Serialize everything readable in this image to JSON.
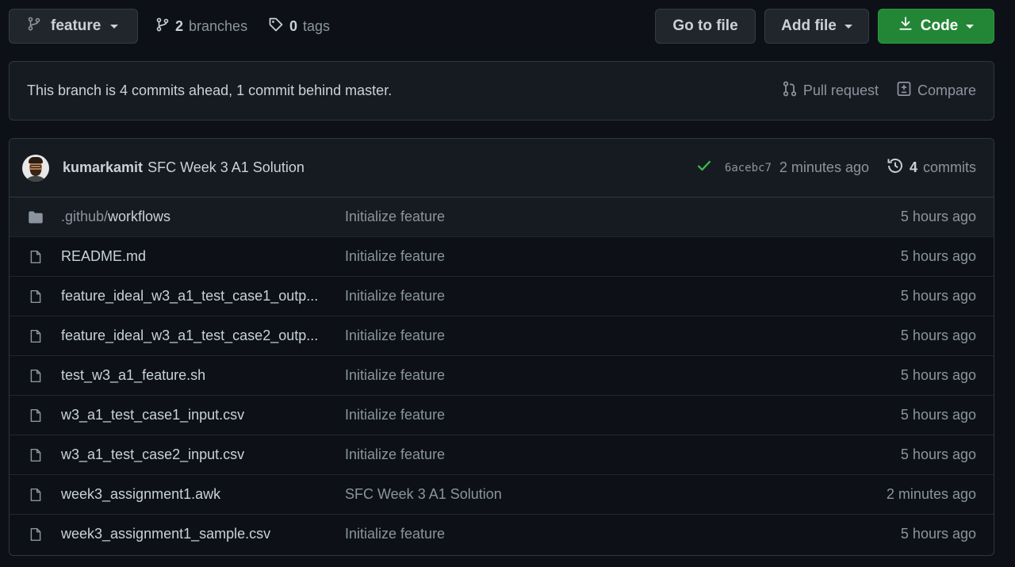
{
  "toolbar": {
    "branch": "feature",
    "branches_count": "2",
    "branches_label": "branches",
    "tags_count": "0",
    "tags_label": "tags",
    "go_to_file": "Go to file",
    "add_file": "Add file",
    "code": "Code"
  },
  "notice": {
    "text": "This branch is 4 commits ahead, 1 commit behind master.",
    "pull_request": "Pull request",
    "compare": "Compare"
  },
  "latest_commit": {
    "author": "kumarkamit",
    "message": "SFC Week 3 A1 Solution",
    "sha": "6acebc7",
    "time": "2 minutes ago",
    "commits_count": "4",
    "commits_label": "commits"
  },
  "files": [
    {
      "type": "folder",
      "name_prefix": ".github/",
      "name": "workflows",
      "message": "Initialize feature",
      "age": "5 hours ago"
    },
    {
      "type": "file",
      "name_prefix": "",
      "name": "README.md",
      "message": "Initialize feature",
      "age": "5 hours ago"
    },
    {
      "type": "file",
      "name_prefix": "",
      "name": "feature_ideal_w3_a1_test_case1_outp...",
      "message": "Initialize feature",
      "age": "5 hours ago"
    },
    {
      "type": "file",
      "name_prefix": "",
      "name": "feature_ideal_w3_a1_test_case2_outp...",
      "message": "Initialize feature",
      "age": "5 hours ago"
    },
    {
      "type": "file",
      "name_prefix": "",
      "name": "test_w3_a1_feature.sh",
      "message": "Initialize feature",
      "age": "5 hours ago"
    },
    {
      "type": "file",
      "name_prefix": "",
      "name": "w3_a1_test_case1_input.csv",
      "message": "Initialize feature",
      "age": "5 hours ago"
    },
    {
      "type": "file",
      "name_prefix": "",
      "name": "w3_a1_test_case2_input.csv",
      "message": "Initialize feature",
      "age": "5 hours ago"
    },
    {
      "type": "file",
      "name_prefix": "",
      "name": "week3_assignment1.awk",
      "message": "SFC Week 3 A1 Solution",
      "age": "2 minutes ago"
    },
    {
      "type": "file",
      "name_prefix": "",
      "name": "week3_assignment1_sample.csv",
      "message": "Initialize feature",
      "age": "5 hours ago"
    }
  ],
  "colors": {
    "background": "#0d1117",
    "panel": "#161b22",
    "border": "#30363d",
    "code_button": "#238636",
    "check": "#3fb950"
  }
}
